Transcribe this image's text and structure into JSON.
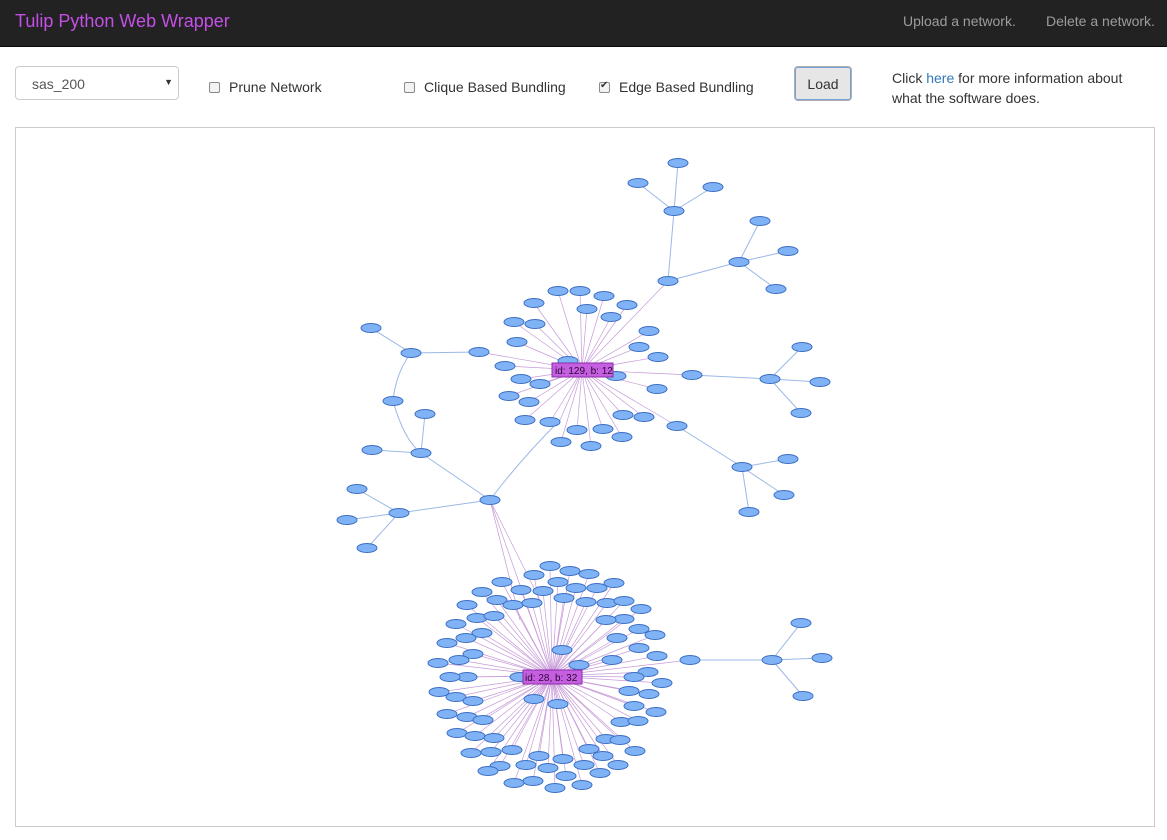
{
  "navbar": {
    "title": "Tulip Python Web Wrapper",
    "upload_link": "Upload a network.",
    "delete_link": "Delete a network."
  },
  "controls": {
    "network_select": {
      "selected": "sas_200"
    },
    "prune": {
      "label": "Prune Network",
      "checked": false
    },
    "clique_bundling": {
      "label": "Clique Based Bundling",
      "checked": false
    },
    "edge_bundling": {
      "label": "Edge Based Bundling",
      "checked": true
    },
    "load_label": "Load",
    "info": {
      "prefix": "Click ",
      "link": "here",
      "suffix": " for more information about what the software does."
    }
  },
  "graph": {
    "hubs": [
      {
        "id": "129",
        "label": "id: 129, b: 12"
      },
      {
        "id": "28",
        "label": "id: 28, b: 32"
      }
    ],
    "colors": {
      "node_fill": "#80b3f5",
      "node_stroke": "#3d6fc4",
      "hub_fill": "#c55ee0",
      "edge_blue": "#9ab8e6",
      "edge_purple": "#c79ad8"
    }
  }
}
